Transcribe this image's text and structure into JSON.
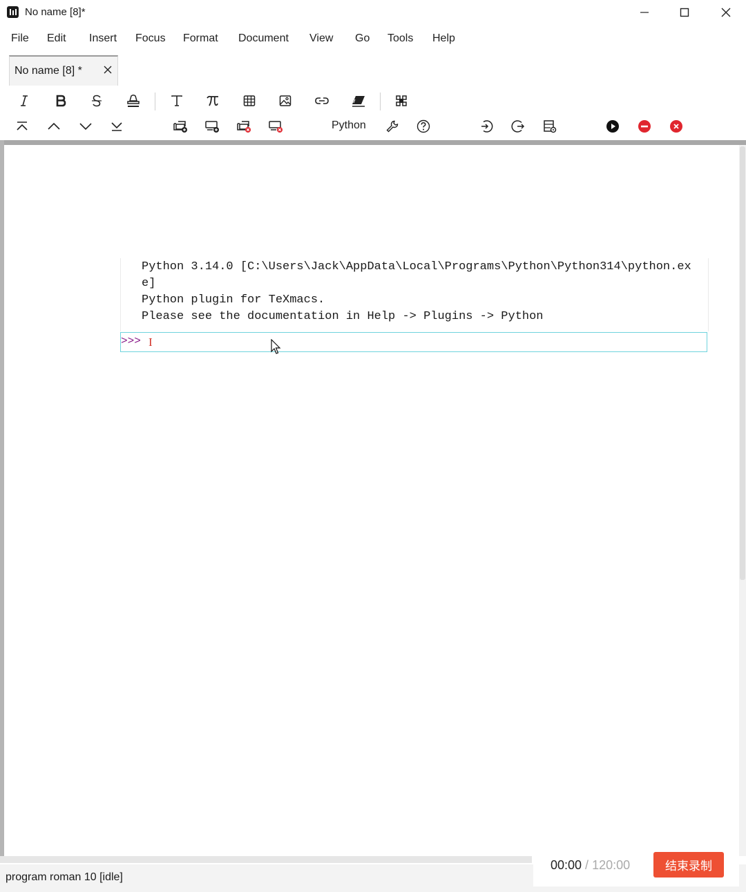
{
  "window": {
    "title": "No name [8]*",
    "controls": [
      "minimize",
      "maximize",
      "close"
    ]
  },
  "menu": [
    "File",
    "Edit",
    "Insert",
    "Focus",
    "Format",
    "Document",
    "View",
    "Go",
    "Tools",
    "Help"
  ],
  "tab": {
    "label": "No name [8] *"
  },
  "toolbar1": {
    "icons": [
      "italic-icon",
      "bold-icon",
      "strikethrough-icon",
      "text-color-icon",
      "text-mode-icon",
      "math-mode-icon",
      "table-icon",
      "image-icon",
      "link-icon",
      "eraser-icon",
      "structure-icon"
    ]
  },
  "toolbar2": {
    "icons": [
      "first-field-icon",
      "previous-field-icon",
      "next-field-icon",
      "last-field-icon",
      "insert-field-above-icon",
      "insert-field-below-icon",
      "remove-field-above-icon",
      "remove-field-below-icon",
      "wrench-icon",
      "help-icon",
      "enter-icon",
      "fold-icon",
      "session-settings-icon",
      "evaluate-icon",
      "interrupt-icon",
      "stop-icon"
    ],
    "session_language": "Python"
  },
  "session": {
    "output_lines": [
      "Python 3.14.0 [C:\\Users\\Jack\\AppData\\Local\\Programs\\Python\\Python314\\python.ex",
      "e]",
      "Python plugin for TeXmacs.",
      "Please see the documentation in Help -> Plugins -> Python"
    ],
    "prompt": ">>>"
  },
  "status": {
    "text": "program roman 10 [idle]"
  },
  "recorder": {
    "elapsed": "00:00",
    "separator": " / ",
    "total": "120:00",
    "stop_label": "结束录制"
  },
  "colors": {
    "prompt": "#8b1e8b",
    "input_border": "#6fd3dd",
    "record_button": "#ee5033",
    "stop_icon": "#e0262e"
  }
}
